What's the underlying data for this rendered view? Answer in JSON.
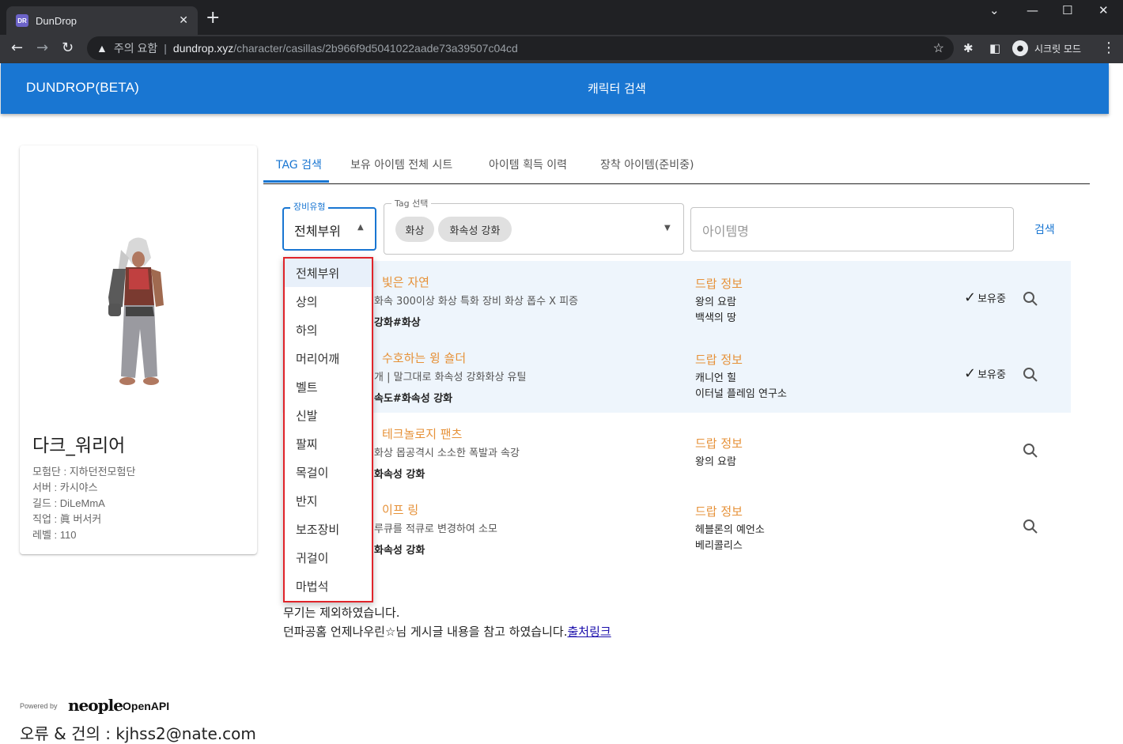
{
  "browser": {
    "tab_title": "DunDrop",
    "tab_favicon": "DR",
    "security_label": "주의 요함",
    "url_host": "dundrop.xyz",
    "url_path": "/character/casillas/2b966f9d5041022aade73a39507c04cd",
    "incognito_label": "시크릿 모드"
  },
  "appbar": {
    "brand": "DUNDROP(BETA)",
    "center_title": "캐릭터 검색",
    "color": "#1976d2"
  },
  "character": {
    "name": "다크_워리어",
    "adventure": "모험단 : 지하던전모험단",
    "server": "서버 : 카시야스",
    "guild": "길드 : DiLeMmA",
    "job": "직업 : 眞 버서커",
    "level": "레벨 : 110"
  },
  "tabs": [
    {
      "label": "TAG 검색",
      "active": true
    },
    {
      "label": "보유 아이템 전체 시트",
      "active": false
    },
    {
      "label": "아이템 획득 이력",
      "active": false
    },
    {
      "label": "장착 아이템(준비중)",
      "active": false
    }
  ],
  "filters": {
    "equip_type_label": "장비유형",
    "equip_type_value": "전체부위",
    "tag_label": "Tag 선택",
    "tags": [
      "화상",
      "화속성 강화"
    ],
    "item_name_placeholder": "아이템명",
    "search_button": "검색"
  },
  "items": [
    {
      "name": "빛은 자연",
      "desc": "화속 300이상 화상 특화 장비 화상 폽수 X 피증",
      "tags": "강화#화상",
      "drop_title": "드랍 정보",
      "drop_locations": [
        "왕의 요람",
        "백색의 땅"
      ],
      "owned": true,
      "owned_label": "보유중"
    },
    {
      "name": "수호하는 윙 숄더",
      "desc": "개 | 말그대로 화속성 강화화상 유틸",
      "tags": "속도#화속성 강화",
      "drop_title": "드랍 정보",
      "drop_locations": [
        "캐니언 힐",
        "이터널 플레임 연구소"
      ],
      "owned": true,
      "owned_label": "보유중"
    },
    {
      "name": "테크놀로지 팬츠",
      "desc": "화상 몹공격시 소소한 폭발과 속강",
      "tags": "화속성 강화",
      "drop_title": "드랍 정보",
      "drop_locations": [
        "왕의 요람"
      ],
      "owned": false,
      "owned_label": ""
    },
    {
      "name": "이프 링",
      "desc": "루큐를 적큐로 변경하여 소모",
      "tags": "화속성 강화",
      "drop_title": "드랍 정보",
      "drop_locations": [
        "헤블론의 예언소",
        "베리콜리스"
      ],
      "owned": false,
      "owned_label": ""
    }
  ],
  "dropdown_options": [
    "전체부위",
    "상의",
    "하의",
    "머리어깨",
    "벨트",
    "신발",
    "팔찌",
    "목걸이",
    "반지",
    "보조장비",
    "귀걸이",
    "마법석"
  ],
  "notes": {
    "line1": "무기는 제외하였습니다.",
    "line2": "던파공홈 언제나우린☆님 게시글 내용을 참고 하였습니다.",
    "link": "출처링크"
  },
  "footer": {
    "powered_by": "Powered by",
    "neople": "neople",
    "openapi": "OpenAPI",
    "contact": "오류 & 건의 : kjhss2@nate.com"
  }
}
